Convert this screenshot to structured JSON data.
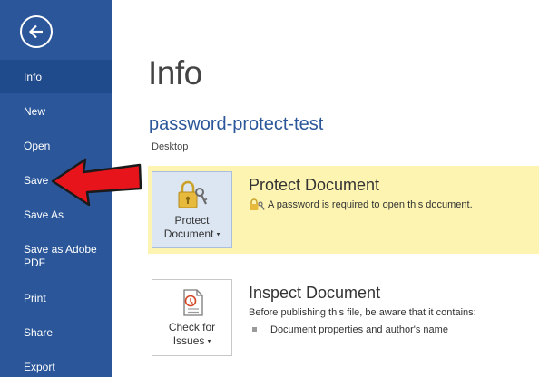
{
  "sidebar": {
    "items": [
      {
        "label": "Info"
      },
      {
        "label": "New"
      },
      {
        "label": "Open"
      },
      {
        "label": "Save"
      },
      {
        "label": "Save As"
      },
      {
        "label": "Save as Adobe",
        "label2": "PDF"
      },
      {
        "label": "Print"
      },
      {
        "label": "Share"
      },
      {
        "label": "Export"
      }
    ],
    "selected": "Info",
    "color": "#2b579a"
  },
  "main": {
    "title": "Info",
    "doc_name": "password-protect-test",
    "doc_location": "Desktop",
    "protect": {
      "button_line1": "Protect",
      "button_line2": "Document",
      "heading": "Protect Document",
      "status": "A password is required to open this document.",
      "highlight_color": "#fcf4b0"
    },
    "inspect": {
      "button_line1": "Check for",
      "button_line2": "Issues",
      "heading": "Inspect Document",
      "description": "Before publishing this file, be aware that it contains:",
      "bullet": "Document properties and author's name"
    }
  },
  "annotation": {
    "arrow_color": "#e8141b",
    "points_to": "Save"
  }
}
